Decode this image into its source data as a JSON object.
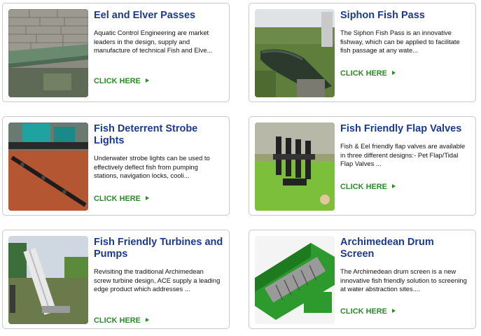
{
  "products": [
    {
      "title": "Eel and Elver Passes",
      "description": "Aquatic Control Engineering are market leaders in the design, supply and manufacture of technical Fish and Elve...",
      "cta": "CLICK HERE"
    },
    {
      "title": "Siphon Fish Pass",
      "description": "The Siphon Fish Pass is an innovative fishway, which can be applied to facilitate fish passage at any wate...",
      "cta": "CLICK HERE"
    },
    {
      "title": "Fish Deterrent Strobe Lights",
      "description": "Underwater strobe lights can be used to effectively deflect fish from pumping stations, navigation locks, cooli...",
      "cta": "CLICK HERE"
    },
    {
      "title": "Fish Friendly Flap Valves",
      "description": "Fish & Eel friendly flap valves are available in three different designs:- Pet Flap/Tidal Flap Valves ...",
      "cta": "CLICK HERE"
    },
    {
      "title": "Fish Friendly Turbines and Pumps",
      "description": "Revisiting the traditional Archimedean screw turbine design, ACE supply a leading edge product which addresses ...",
      "cta": "CLICK HERE"
    },
    {
      "title": "Archimedean Drum Screen",
      "description": "The Archimedean drum screen is a new innovative fish friendly solution to screening at water abstraction sites....",
      "cta": "CLICK HERE"
    }
  ],
  "colors": {
    "title": "#1c3a8c",
    "cta": "#2a8a2a",
    "border": "#c9c9c9"
  }
}
